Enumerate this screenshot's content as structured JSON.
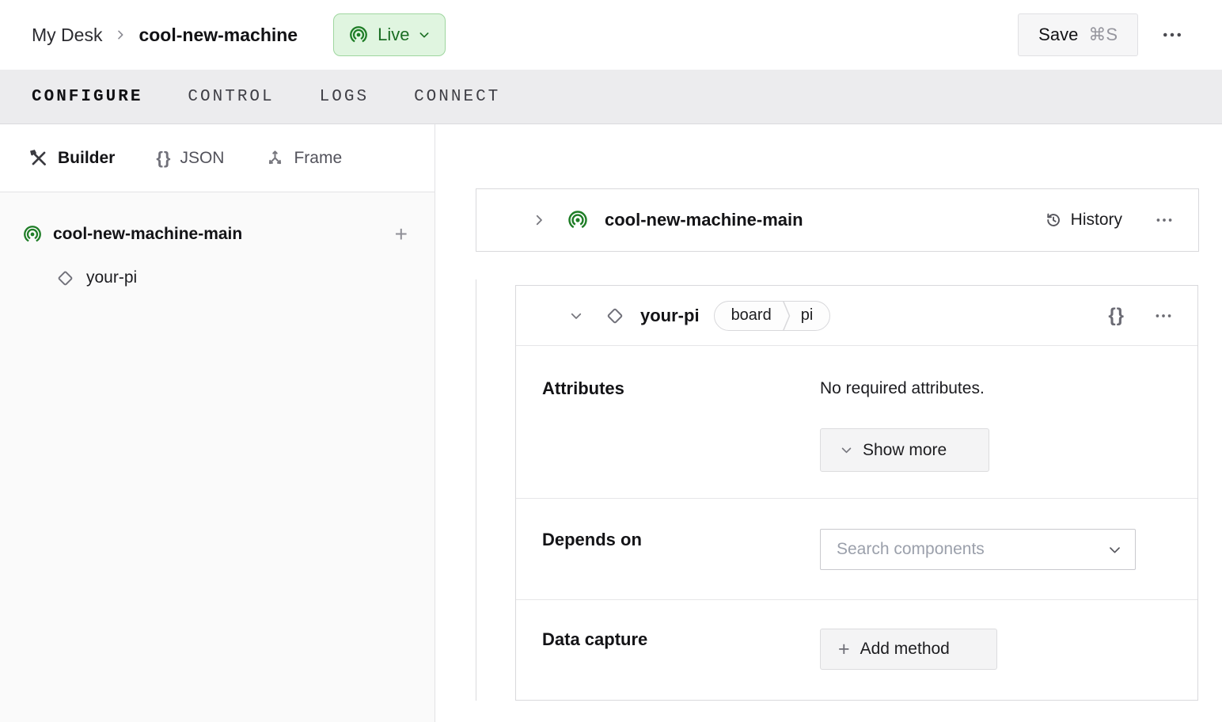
{
  "header": {
    "breadcrumb": {
      "root": "My Desk",
      "current": "cool-new-machine"
    },
    "status": {
      "label": "Live"
    },
    "save": {
      "label": "Save",
      "shortcut": "⌘S"
    }
  },
  "tabs": [
    {
      "label": "CONFIGURE",
      "active": true
    },
    {
      "label": "CONTROL",
      "active": false
    },
    {
      "label": "LOGS",
      "active": false
    },
    {
      "label": "CONNECT",
      "active": false
    }
  ],
  "sidebar": {
    "modes": [
      {
        "label": "Builder",
        "active": true
      },
      {
        "label": "JSON",
        "active": false
      },
      {
        "label": "Frame",
        "active": false
      }
    ],
    "tree": {
      "machine_name": "cool-new-machine-main",
      "components": [
        {
          "name": "your-pi"
        }
      ]
    }
  },
  "main": {
    "machine_card": {
      "title": "cool-new-machine-main",
      "history_label": "History"
    },
    "component_card": {
      "title": "your-pi",
      "badge": {
        "type": "board",
        "model": "pi"
      },
      "attributes": {
        "label": "Attributes",
        "empty_text": "No required attributes.",
        "show_more_label": "Show more"
      },
      "depends_on": {
        "label": "Depends on",
        "search_placeholder": "Search components"
      },
      "data_capture": {
        "label": "Data capture",
        "add_method_label": "Add method"
      }
    }
  },
  "glyphs": {
    "braces": "{}",
    "plus": "+"
  },
  "colors": {
    "live_text_green": "#1b6e23",
    "live_bg_green": "#e0f5e0",
    "live_border_green": "#9fd69f",
    "brand_icon_green": "#1e7d26",
    "tabbar_bg": "#ececee",
    "sidebar_bg": "#fafafa",
    "card_border": "#d9d9dc"
  }
}
